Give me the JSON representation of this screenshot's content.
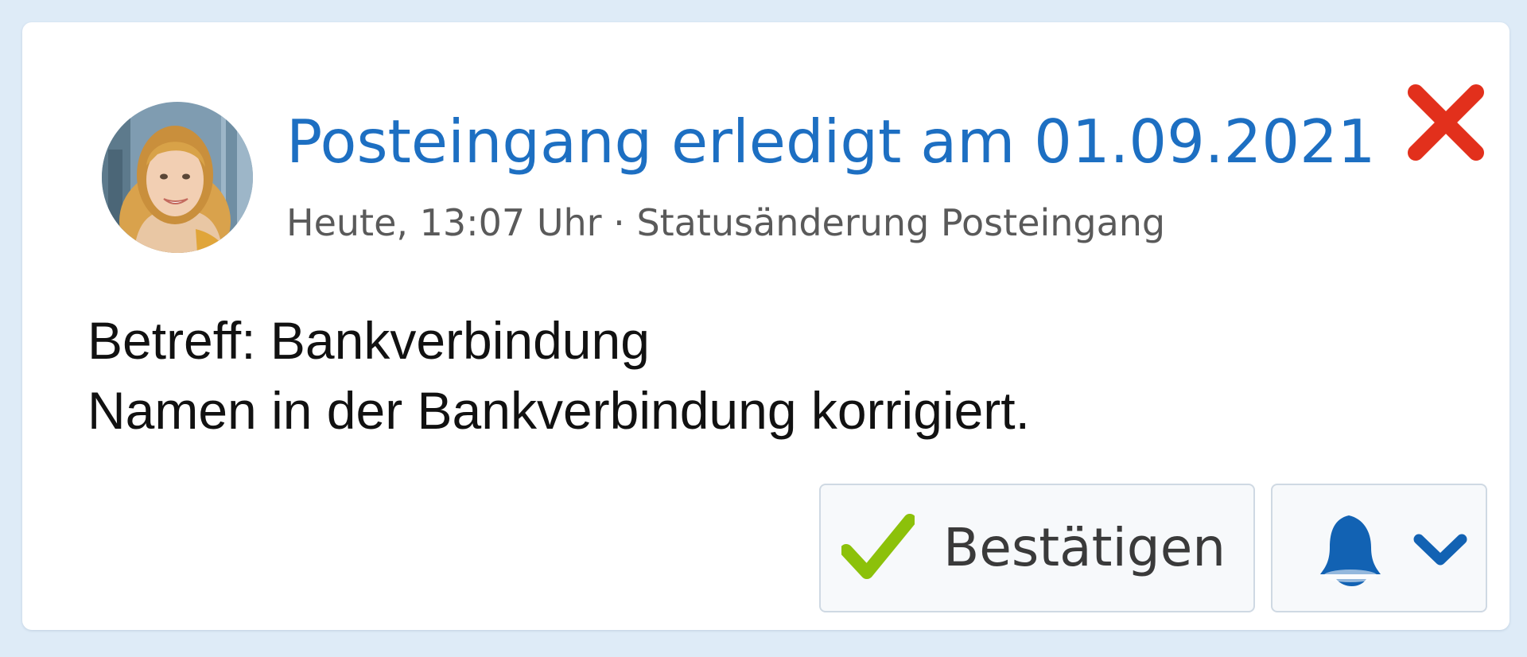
{
  "notification": {
    "title": "Posteingang erledigt am 01.09.2021",
    "timestamp": "Heute, 13:07 Uhr",
    "separator": " · ",
    "category": "Statusänderung Posteingang",
    "body_lines": [
      "Betreff: Bankverbindung",
      "Namen in der Bankverbindung korrigiert."
    ],
    "avatar_icon": "user-portrait",
    "close_icon": "close-icon"
  },
  "actions": {
    "confirm_label": "Bestätigen",
    "confirm_icon": "checkmark-icon",
    "notify_icon": "bell-icon",
    "notify_menu_icon": "chevron-down-icon"
  },
  "colors": {
    "background": "#deebf7",
    "title": "#1d6fc2",
    "close": "#e2301c",
    "check": "#8cc10a",
    "bell": "#1262b3"
  }
}
